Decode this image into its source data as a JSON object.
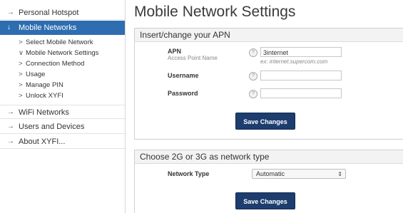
{
  "sidebar": {
    "items": [
      {
        "label": "Personal Hotspot",
        "arrow": "→"
      },
      {
        "label": "Mobile Networks",
        "arrow": "↓"
      },
      {
        "label": "WiFi Networks",
        "arrow": "→"
      },
      {
        "label": "Users and Devices",
        "arrow": "→"
      },
      {
        "label": "About XYFI...",
        "arrow": "→"
      }
    ],
    "subitems": [
      {
        "label": "Select Mobile Network",
        "marker": ">"
      },
      {
        "label": "Mobile Network Settings",
        "marker": "∨"
      },
      {
        "label": "Connection Method",
        "marker": ">"
      },
      {
        "label": "Usage",
        "marker": ">"
      },
      {
        "label": "Manage PIN",
        "marker": ">"
      },
      {
        "label": "Unlock XYFI",
        "marker": ">"
      }
    ]
  },
  "main": {
    "title": "Mobile Network Settings",
    "apn_section": {
      "heading": "Insert/change your APN",
      "apn_label": "APN",
      "apn_sublabel": "Access Point Name",
      "apn_value": "3internet",
      "apn_hint": "ex: internet.supercom.com",
      "username_label": "Username",
      "username_value": "",
      "password_label": "Password",
      "password_value": "",
      "save_label": "Save Changes"
    },
    "network_section": {
      "heading": "Choose 2G or 3G as network type",
      "type_label": "Network Type",
      "type_value": "Automatic",
      "save_label": "Save Changes"
    },
    "help_glyph": "?"
  },
  "colors": {
    "active_nav": "#2e6db0",
    "button": "#1d3d6f"
  }
}
